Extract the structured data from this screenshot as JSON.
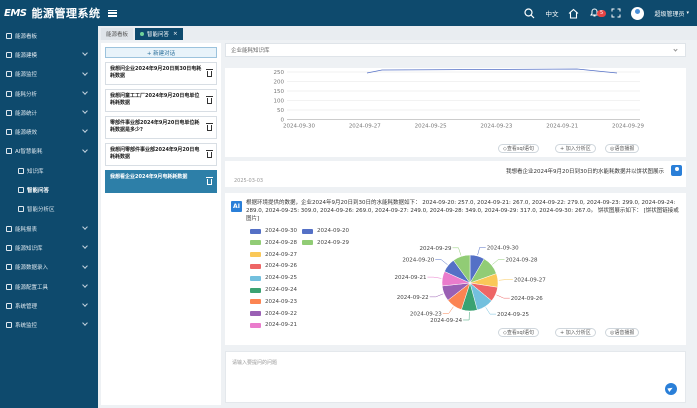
{
  "header": {
    "logo_mark": "EMS",
    "title": "能源管理系统",
    "lang": "中文",
    "notif_count": "5",
    "user": "超级管理员"
  },
  "sidebar": {
    "items": [
      {
        "label": "能源看板",
        "expandable": false
      },
      {
        "label": "能源建模",
        "expandable": true
      },
      {
        "label": "能源监控",
        "expandable": true
      },
      {
        "label": "能耗分析",
        "expandable": true
      },
      {
        "label": "能源统计",
        "expandable": true
      },
      {
        "label": "能源绩效",
        "expandable": true
      },
      {
        "label": "AI智慧能耗",
        "expandable": true
      },
      {
        "label": "知识库",
        "sub": true
      },
      {
        "label": "智能问答",
        "sub": true,
        "active": true
      },
      {
        "label": "智能分析区",
        "sub": true
      },
      {
        "label": "能耗报表",
        "expandable": true
      },
      {
        "label": "能源知识库",
        "expandable": true
      },
      {
        "label": "能源数据录入",
        "expandable": true
      },
      {
        "label": "能源配置工具",
        "expandable": true
      },
      {
        "label": "系统管理",
        "expandable": true
      },
      {
        "label": "系统监控",
        "expandable": true
      }
    ]
  },
  "tabs": [
    {
      "label": "能源看板"
    },
    {
      "label": "智能问答"
    }
  ],
  "conversations": {
    "new_label": "+ 新建对话",
    "items": [
      {
        "label": "我想问企业2024年9月20日到30日电耗耗数据"
      },
      {
        "label": "我想问童工工厂2024年9月20日电单位耗耗数据"
      },
      {
        "label": "零部件事业部2024年9月20日电单位耗耗数据是多少?"
      },
      {
        "label": "我想问零部件事业部2024年9月20日电耗耗数据"
      },
      {
        "label": "我想看企业2024年9月电耗耗数据",
        "active": true
      }
    ]
  },
  "kb_select": {
    "value": "企业能耗知识库"
  },
  "top_chart": {
    "ytick_top": "250",
    "ytick_partial": "200"
  },
  "actions": {
    "view_sql": "◇查看sql语句",
    "add_analysis": "+ 加入分析区",
    "voice": "◎语音播报"
  },
  "user_question": {
    "text": "我想看企业2024年9月20日到30日的水能耗数据并以饼状图展示",
    "date": "2025-03-03"
  },
  "ai_answer": {
    "badge": "AI",
    "text": "根据环境提供的数据，企业2024年9月20日到30日的水能耗数据如下： 2024-09-20: 257.0, 2024-09-21: 267.0, 2024-09-22: 279.0, 2024-09-23: 299.0, 2024-09-24: 289.0, 2024-09-25: 309.0, 2024-09-26: 269.0, 2024-09-27: 249.0, 2024-09-28: 349.0, 2024-09-29: 317.0, 2024-09-30: 267.0。 饼状图展示如下： [饼状图链接或图片]"
  },
  "input": {
    "placeholder": "请输入要提问的问题"
  },
  "colors": {
    "sidebar": "#0e4a6d",
    "accent": "#2a7fd8",
    "active_conv": "#2d7fa8"
  },
  "chart_data": [
    {
      "type": "line",
      "x": [
        "2024-09-30",
        "2024-09-27",
        "2024-09-25",
        "2024-09-23",
        "2024-09-21",
        "2024-09-29"
      ],
      "yticks": [
        250,
        200,
        150,
        100,
        50,
        0
      ],
      "ylim": [
        0,
        250
      ],
      "note": "partially scrolled; only x-axis and gridlines visible"
    },
    {
      "type": "pie",
      "title": "",
      "legend_position": "left",
      "categories": [
        "2024-09-30",
        "2024-09-28",
        "2024-09-27",
        "2024-09-26",
        "2024-09-25",
        "2024-09-24",
        "2024-09-23",
        "2024-09-22",
        "2024-09-21",
        "2024-09-20",
        "2024-09-29"
      ],
      "values": [
        267,
        349,
        249,
        269,
        309,
        289,
        299,
        279,
        267,
        257,
        317
      ],
      "colors": [
        "#5470c6",
        "#91cc75",
        "#fac858",
        "#ee6666",
        "#73c0de",
        "#3ba272",
        "#fc8452",
        "#9a60b4",
        "#ea7ccc",
        "#5470c6",
        "#91cc75"
      ]
    }
  ]
}
